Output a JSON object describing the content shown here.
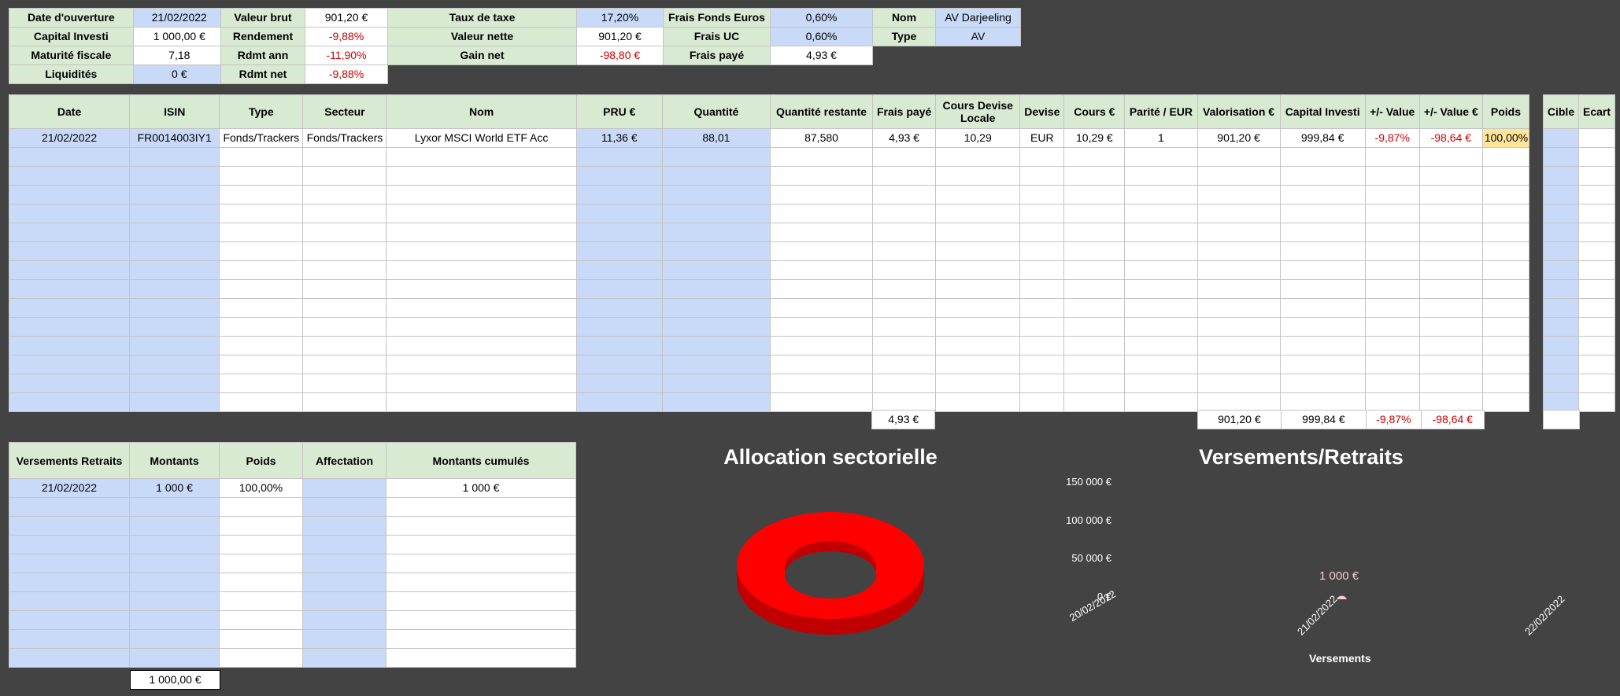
{
  "summary": {
    "block1": [
      {
        "label": "Date d'ouverture",
        "value": "21/02/2022",
        "style": "b"
      },
      {
        "label": "Capital Investi",
        "value": "1 000,00 €",
        "style": "w"
      },
      {
        "label": "Maturité fiscale",
        "value": "7,18",
        "style": "w"
      },
      {
        "label": "Liquidités",
        "value": "0 €",
        "style": "b"
      }
    ],
    "block2": [
      {
        "label": "Valeur brut",
        "value": "901,20 €",
        "red": false
      },
      {
        "label": "Rendement",
        "value": "-9,88%",
        "red": true
      },
      {
        "label": "Rdmt ann",
        "value": "-11,90%",
        "red": true
      },
      {
        "label": "Rdmt net",
        "value": "-9,88%",
        "red": true
      }
    ],
    "block3": [
      {
        "label": "Taux de taxe",
        "value": "17,20%",
        "style": "b",
        "red": false
      },
      {
        "label": "Valeur nette",
        "value": "901,20 €",
        "style": "w",
        "red": false
      },
      {
        "label": "Gain net",
        "value": "-98,80 €",
        "style": "w",
        "red": true
      }
    ],
    "block4": [
      {
        "label": "Frais Fonds Euros",
        "value": "0,60%",
        "style": "b"
      },
      {
        "label": "Frais UC",
        "value": "0,60%",
        "style": "b"
      },
      {
        "label": "Frais payé",
        "value": "4,93 €",
        "style": "w"
      }
    ],
    "block5": [
      {
        "label": "Nom",
        "value": "AV Darjeeling"
      },
      {
        "label": "Type",
        "value": "AV"
      }
    ]
  },
  "positions": {
    "headers": [
      "Date",
      "ISIN",
      "Type",
      "Secteur",
      "Nom",
      "PRU €",
      "Quantité",
      "Quantité restante",
      "Frais payé",
      "Cours Devise Locale",
      "Devise",
      "Cours €",
      "Parité / EUR",
      "Valorisation €",
      "Capital Investi",
      "+/- Value",
      "+/- Value €",
      "Poids"
    ],
    "row": [
      "21/02/2022",
      "FR0014003IY1",
      "Fonds/Trackers",
      "Fonds/Trackers",
      "Lyxor MSCI World ETF Acc",
      "11,36 €",
      "88,01",
      "87,580",
      "4,93 €",
      "10,29",
      "EUR",
      "10,29 €",
      "1",
      "901,20 €",
      "999,84 €",
      "-9,87%",
      "-98,64 €",
      "100,00%"
    ],
    "totals": {
      "frais": "4,93 €",
      "valorisation": "901,20 €",
      "capital": "999,84 €",
      "pv_pct": "-9,87%",
      "pv_eur": "-98,64 €"
    },
    "side_headers": [
      "Cible",
      "Ecart"
    ]
  },
  "versements": {
    "headers": [
      "Versements Retraits",
      "Montants",
      "Poids",
      "Affectation",
      "Montants cumulés"
    ],
    "row": [
      "21/02/2022",
      "1 000 €",
      "100,00%",
      "",
      "1 000 €"
    ],
    "total": "1 000,00 €"
  },
  "charts": {
    "allocation_title": "Allocation sectorielle",
    "versements_title": "Versements/Retraits",
    "legend_label": "Versements",
    "point_label": "1 000 €",
    "color_pie": "#ff0000",
    "color_point": "#f4cccc"
  },
  "chart_data": [
    {
      "type": "pie",
      "title": "Allocation sectorielle",
      "categories": [
        "Fonds/Trackers"
      ],
      "values": [
        100
      ]
    },
    {
      "type": "scatter",
      "title": "Versements/Retraits",
      "categories": [
        "20/02/2022",
        "21/02/2022",
        "22/02/2022"
      ],
      "yticks": [
        "0 €",
        "50 000 €",
        "100 000 €",
        "150 000 €"
      ],
      "ylim": [
        0,
        150000
      ],
      "series": [
        {
          "name": "Versements",
          "values": [
            null,
            1000,
            null
          ]
        }
      ]
    }
  ]
}
